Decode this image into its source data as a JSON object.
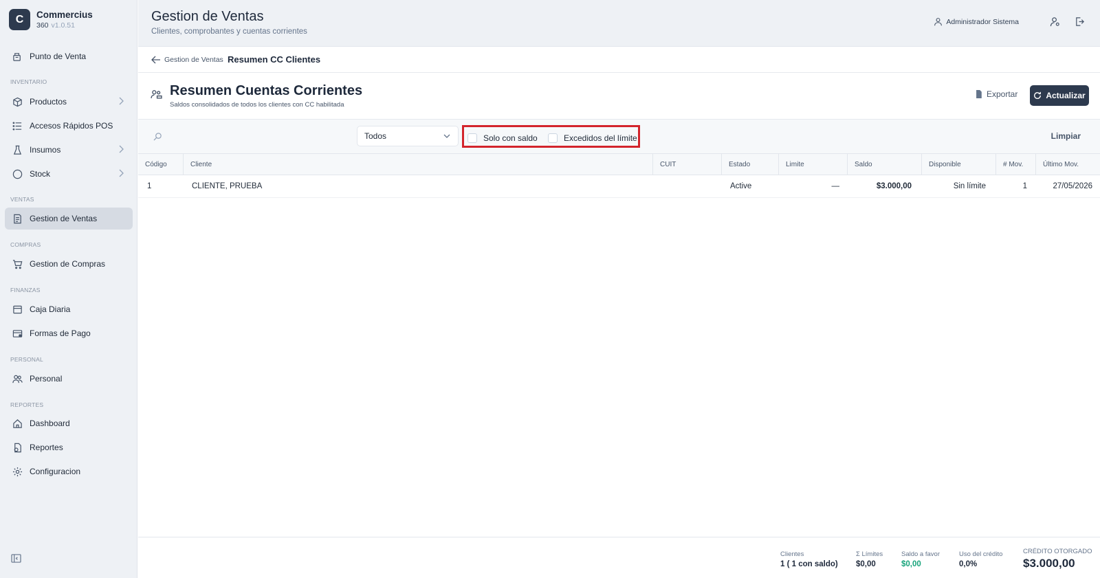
{
  "app": {
    "logo_letter": "C",
    "name": "Commercius",
    "edition": "360",
    "version": "v1.0.51"
  },
  "sidebar": {
    "items": [
      {
        "label": "Punto de Venta"
      },
      {
        "section": "INVENTARIO"
      },
      {
        "label": "Productos"
      },
      {
        "label": "Accesos Rápidos POS"
      },
      {
        "label": "Insumos"
      },
      {
        "label": "Stock"
      },
      {
        "section": "VENTAS"
      },
      {
        "label": "Gestion de Ventas"
      },
      {
        "section": "COMPRAS"
      },
      {
        "label": "Gestion de Compras"
      },
      {
        "section": "FINANZAS"
      },
      {
        "label": "Caja Diaria"
      },
      {
        "label": "Formas de Pago"
      },
      {
        "section": "PERSONAL"
      },
      {
        "label": "Personal"
      },
      {
        "section": "REPORTES"
      },
      {
        "label": "Dashboard"
      },
      {
        "label": "Reportes"
      },
      {
        "label": "Configuracion"
      }
    ]
  },
  "header": {
    "title": "Gestion de Ventas",
    "subtitle": "Clientes, comprobantes y cuentas corrientes",
    "user": "Administrador Sistema"
  },
  "breadcrumb": {
    "back_label": "Gestion de Ventas",
    "current": "Resumen CC Clientes"
  },
  "section": {
    "title": "Resumen Cuentas Corrientes",
    "subtitle": "Saldos consolidados de todos los clientes con CC habilitada",
    "export_label": "Exportar",
    "refresh_label": "Actualizar"
  },
  "filters": {
    "select_value": "Todos",
    "check_saldo": "Solo con saldo",
    "check_limite": "Excedidos del límite",
    "clear_label": "Limpiar"
  },
  "table": {
    "columns": [
      "Código",
      "Cliente",
      "CUIT",
      "Estado",
      "Limite",
      "Saldo",
      "Disponible",
      "# Mov.",
      "Último Mov."
    ],
    "rows": [
      [
        "1",
        "CLIENTE, PRUEBA",
        "",
        "Active",
        "—",
        "$3.000,00",
        "Sin límite",
        "1",
        "27/05/2026"
      ]
    ]
  },
  "footer": {
    "clientes_label": "Clientes",
    "clientes_value": "1  ( 1  con saldo)",
    "limites_label": "Σ Límites",
    "limites_value": "$0,00",
    "favor_label": "Saldo a favor",
    "favor_value": "$0,00",
    "uso_label": "Uso del crédito",
    "uso_value": "0,0%",
    "credito_label": "CRÉDITO OTORGADO",
    "credito_value": "$3.000,00"
  },
  "colors": {
    "accent": "#2d3a4e",
    "highlight": "#d3242c",
    "positive": "#16a37a"
  }
}
